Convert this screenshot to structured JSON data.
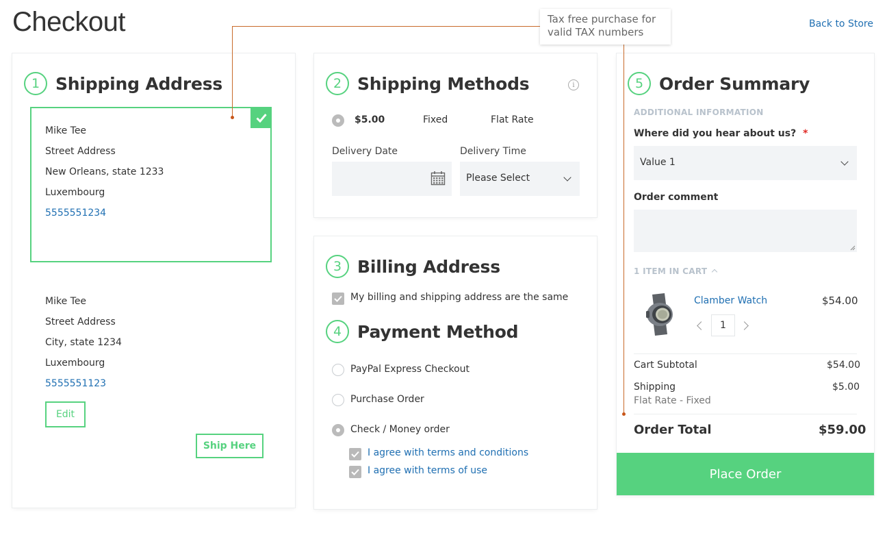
{
  "header": {
    "title": "Checkout",
    "back_link": "Back to Store"
  },
  "tooltip": {
    "text_line1": "Tax free purchase for",
    "text_line2": "valid TAX numbers"
  },
  "shipping_address": {
    "step": "1",
    "title": "Shipping Address",
    "selected": {
      "name": "Mike Tee",
      "street": "Street Address",
      "city": "New Orleans, state 1233",
      "country": "Luxembourg",
      "phone": "5555551234"
    },
    "other": {
      "name": "Mike Tee",
      "street": "Street Address",
      "city": "City, state 1234",
      "country": "Luxembourg",
      "phone": "5555551123"
    },
    "edit_label": "Edit",
    "ship_here_label": "Ship Here"
  },
  "shipping_methods": {
    "step": "2",
    "title": "Shipping Methods",
    "rate": {
      "price": "$5.00",
      "method": "Fixed",
      "carrier": "Flat Rate",
      "selected": true
    },
    "delivery_date_label": "Delivery Date",
    "delivery_time_label": "Delivery Time",
    "delivery_time_value": "Please Select"
  },
  "billing_address": {
    "step": "3",
    "title": "Billing Address",
    "same_as_shipping_label": "My billing and shipping address are the same",
    "same_as_shipping_checked": true
  },
  "payment_method": {
    "step": "4",
    "title": "Payment Method",
    "options": [
      {
        "label": "PayPal Express Checkout",
        "selected": false
      },
      {
        "label": "Purchase Order",
        "selected": false
      },
      {
        "label": "Check / Money order",
        "selected": true
      }
    ],
    "agreements": [
      {
        "label": "I agree with terms and conditions",
        "checked": true
      },
      {
        "label": "I agree with terms of use",
        "checked": true
      }
    ]
  },
  "order_summary": {
    "step": "5",
    "title": "Order Summary",
    "additional_info_heading": "ADDITIONAL INFORMATION",
    "hear_about_label": "Where did you hear about us?",
    "required_mark": "*",
    "hear_about_value": "Value 1",
    "comment_label": "Order comment",
    "items_in_cart": "1 ITEM IN CART",
    "item": {
      "name": "Clamber Watch",
      "price": "$54.00",
      "qty": "1"
    },
    "subtotal_label": "Cart Subtotal",
    "subtotal_value": "$54.00",
    "shipping_label": "Shipping",
    "shipping_method": "Flat Rate - Fixed",
    "shipping_value": "$5.00",
    "total_label": "Order Total",
    "total_value": "$59.00",
    "place_order_label": "Place Order"
  },
  "colors": {
    "accent": "#56d27f",
    "link": "#1f6fb2",
    "field_bg": "#f2f4f6",
    "leader": "#c86a2a"
  }
}
